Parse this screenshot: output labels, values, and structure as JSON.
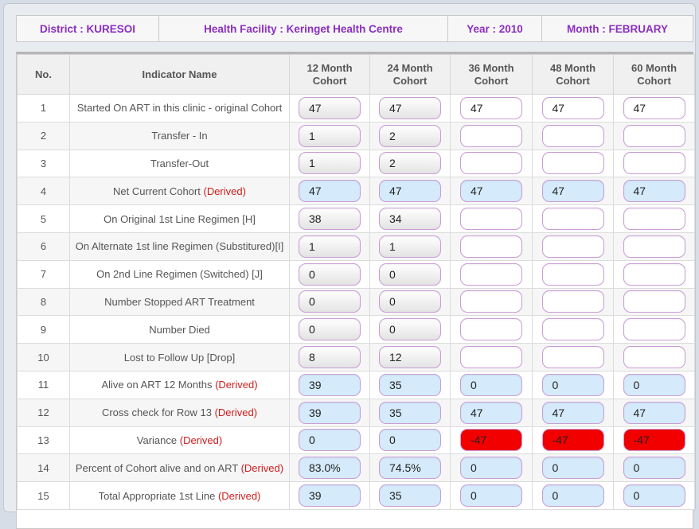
{
  "header": {
    "district": "District : KURESOI",
    "facility": "Health Facility : Keringet Health Centre",
    "year": "Year : 2010",
    "month": "Month : FEBRUARY"
  },
  "columns": {
    "no": "No.",
    "indicator": "Indicator Name",
    "c12_l1": "12 Month",
    "c12_l2": "Cohort",
    "c24_l1": "24 Month",
    "c24_l2": "Cohort",
    "c36_l1": "36 Month",
    "c36_l2": "Cohort",
    "c48_l1": "48 Month",
    "c48_l2": "Cohort",
    "c60_l1": "60 Month",
    "c60_l2": "Cohort"
  },
  "rows": [
    {
      "no": "1",
      "name": "Started On ART in this clinic - original Cohort",
      "derived": "",
      "v": [
        "47",
        "47",
        "47",
        "47",
        "47"
      ],
      "s": [
        "grey",
        "grey",
        "white",
        "white",
        "white"
      ]
    },
    {
      "no": "2",
      "name": "Transfer - In",
      "derived": "",
      "v": [
        "1",
        "2",
        "",
        "",
        ""
      ],
      "s": [
        "grey",
        "grey",
        "white",
        "white",
        "white"
      ]
    },
    {
      "no": "3",
      "name": "Transfer-Out",
      "derived": "",
      "v": [
        "1",
        "2",
        "",
        "",
        ""
      ],
      "s": [
        "grey",
        "grey",
        "white",
        "white",
        "white"
      ]
    },
    {
      "no": "4",
      "name": "Net Current Cohort",
      "derived": "(Derived)",
      "v": [
        "47",
        "47",
        "47",
        "47",
        "47"
      ],
      "s": [
        "blue",
        "blue",
        "blue",
        "blue",
        "blue"
      ]
    },
    {
      "no": "5",
      "name": "On Original 1st Line Regimen [H]",
      "derived": "",
      "v": [
        "38",
        "34",
        "",
        "",
        ""
      ],
      "s": [
        "grey",
        "grey",
        "white",
        "white",
        "white"
      ]
    },
    {
      "no": "6",
      "name": "On Alternate 1st line Regimen (Substitured)[I]",
      "derived": "",
      "v": [
        "1",
        "1",
        "",
        "",
        ""
      ],
      "s": [
        "grey",
        "grey",
        "white",
        "white",
        "white"
      ]
    },
    {
      "no": "7",
      "name": "On 2nd Line Regimen (Switched) [J]",
      "derived": "",
      "v": [
        "0",
        "0",
        "",
        "",
        ""
      ],
      "s": [
        "grey",
        "grey",
        "white",
        "white",
        "white"
      ]
    },
    {
      "no": "8",
      "name": "Number Stopped ART Treatment",
      "derived": "",
      "v": [
        "0",
        "0",
        "",
        "",
        ""
      ],
      "s": [
        "grey",
        "grey",
        "white",
        "white",
        "white"
      ]
    },
    {
      "no": "9",
      "name": "Number Died",
      "derived": "",
      "v": [
        "0",
        "0",
        "",
        "",
        ""
      ],
      "s": [
        "grey",
        "grey",
        "white",
        "white",
        "white"
      ]
    },
    {
      "no": "10",
      "name": "Lost to Follow Up [Drop]",
      "derived": "",
      "v": [
        "8",
        "12",
        "",
        "",
        ""
      ],
      "s": [
        "grey",
        "grey",
        "white",
        "white",
        "white"
      ]
    },
    {
      "no": "11",
      "name": "Alive on ART 12 Months",
      "derived": "(Derived)",
      "v": [
        "39",
        "35",
        "0",
        "0",
        "0"
      ],
      "s": [
        "blue",
        "blue",
        "blue",
        "blue",
        "blue"
      ]
    },
    {
      "no": "12",
      "name": "Cross check for Row 13",
      "derived": "(Derived)",
      "v": [
        "39",
        "35",
        "47",
        "47",
        "47"
      ],
      "s": [
        "blue",
        "blue",
        "blue",
        "blue",
        "blue"
      ]
    },
    {
      "no": "13",
      "name": "Variance",
      "derived": "(Derived)",
      "v": [
        "0",
        "0",
        "-47",
        "-47",
        "-47"
      ],
      "s": [
        "blue",
        "blue",
        "red",
        "red",
        "red"
      ]
    },
    {
      "no": "14",
      "name": "Percent of Cohort alive and on ART",
      "derived": "(Derived)",
      "v": [
        "83.0%",
        "74.5%",
        "0",
        "0",
        "0"
      ],
      "s": [
        "blue",
        "blue",
        "blue",
        "blue",
        "blue"
      ]
    },
    {
      "no": "15",
      "name": "Total Appropriate 1st Line",
      "derived": "(Derived)",
      "v": [
        "39",
        "35",
        "0",
        "0",
        "0"
      ],
      "s": [
        "blue",
        "blue",
        "blue",
        "blue",
        "blue"
      ]
    }
  ],
  "colors": {
    "header_text": "#8b2ec0",
    "derived_text": "#d11c1c",
    "derived_field": "#d5ebfb",
    "variance_alert": "#f20000",
    "field_border": "#c99cd6"
  }
}
